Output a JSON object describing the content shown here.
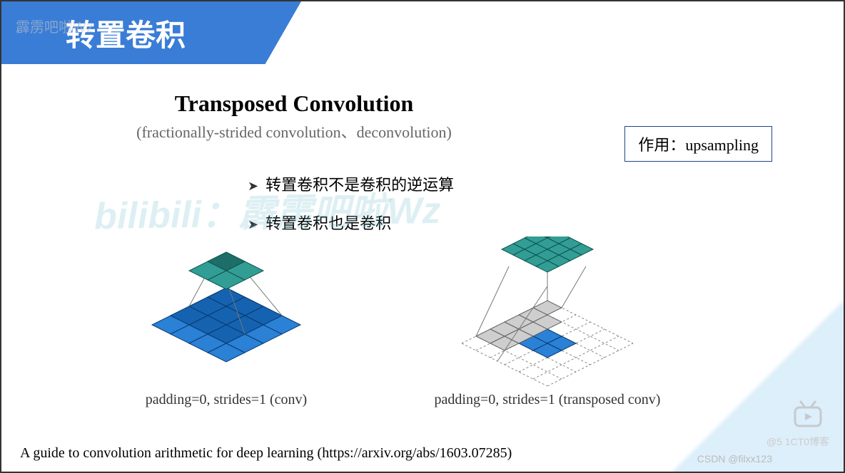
{
  "banner": "转置卷积",
  "watermark_topleft": "霹雳吧啦Wz",
  "watermark_center": "bilibili：霹雳吧啦Wz",
  "heading": {
    "title": "Transposed Convolution",
    "subtitle": "(fractionally-strided convolution、deconvolution)"
  },
  "badge": "作用：upsampling",
  "bullets": [
    "转置卷积不是卷积的逆运算",
    "转置卷积也是卷积"
  ],
  "diagrams": {
    "left_caption": "padding=0, strides=1 (conv)",
    "right_caption": "padding=0, strides=1 (transposed conv)"
  },
  "reference": "A guide to convolution arithmetic for deep learning (https://arxiv.org/abs/1603.07285)",
  "csdn": "CSDN @filxx123",
  "trmark": "@5 1CT0博客"
}
